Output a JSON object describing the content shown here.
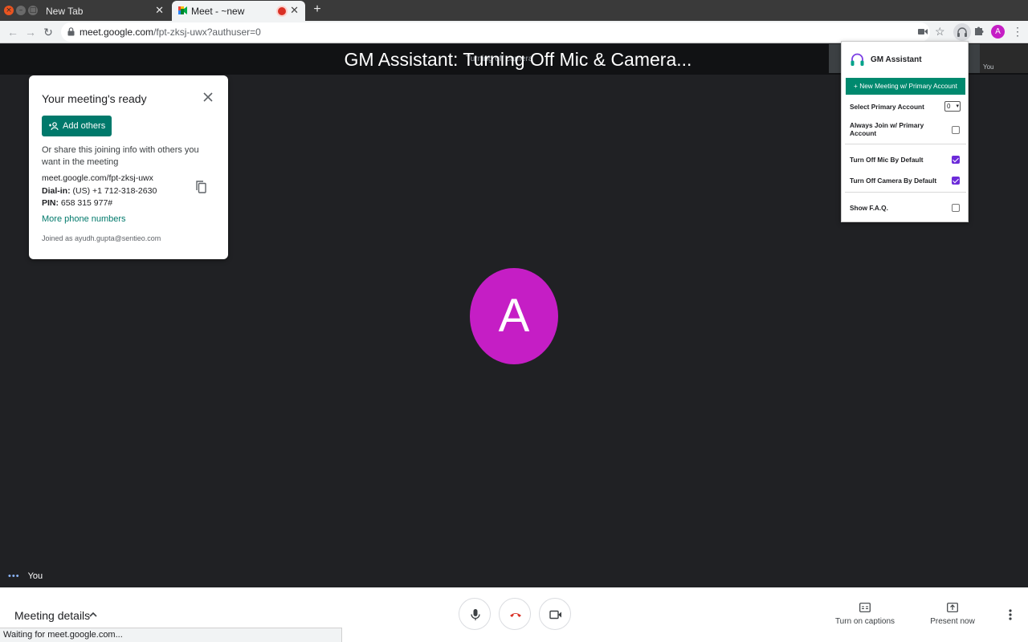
{
  "browser": {
    "tabs": [
      {
        "title": "New Tab",
        "active": false
      },
      {
        "title": "Meet - ~new",
        "active": true,
        "recording": true
      }
    ],
    "omnibox": {
      "host": "meet.google.com",
      "path": "/fpt-zksj-uwx?authuser=0"
    },
    "window_controls": {
      "close": "×",
      "minimize": "–",
      "maximize": "□"
    },
    "icons": {
      "back": "back-arrow-icon",
      "forward": "forward-arrow-icon",
      "reload": "reload-icon",
      "lock": "lock-icon",
      "camera": "camera-icon",
      "star": "star-icon",
      "extension": "headset-icon",
      "puzzle": "puzzle-icon",
      "menu": "kebab-icon"
    },
    "profile_initial": "A"
  },
  "meet": {
    "overlay_title": "GM Assistant: Turning Off Mic & Camera...",
    "ghost_label": "Turning off camera",
    "self_tile_label": "You",
    "main_avatar_initial": "A",
    "you_label": "You",
    "colors": {
      "avatar": "#c51ec5",
      "accent": "#00796b",
      "checkbox": "#6c2bd9",
      "hangup": "#d93025"
    }
  },
  "ready_card": {
    "title": "Your meeting's ready",
    "add_others_label": "Add others",
    "share_text": "Or share this joining info with others you want in the meeting",
    "join_url": "meet.google.com/fpt-zksj-uwx",
    "dial_in_label": "Dial-in:",
    "dial_in_value": " (US) +1 712-318-2630",
    "pin_label": "PIN:",
    "pin_value": " 658 315 977#",
    "more_phone_numbers": "More phone numbers",
    "joined_as": "Joined as ayudh.gupta@sentieo.com"
  },
  "extension_popup": {
    "title": "GM Assistant",
    "new_meeting_button": "+ New Meeting w/ Primary Account",
    "select_primary_label": "Select Primary Account",
    "select_primary_value": "0",
    "rows": [
      {
        "label": "Always Join w/ Primary Account",
        "checked": false
      },
      {
        "label": "Turn Off Mic By Default",
        "checked": true
      },
      {
        "label": "Turn Off Camera By Default",
        "checked": true
      },
      {
        "label": "Show F.A.Q.",
        "checked": false
      }
    ]
  },
  "bottom_bar": {
    "meeting_details": "Meeting details",
    "turn_on_captions": "Turn on captions",
    "present_now": "Present now"
  },
  "status_bar": {
    "text": "Waiting for meet.google.com..."
  }
}
